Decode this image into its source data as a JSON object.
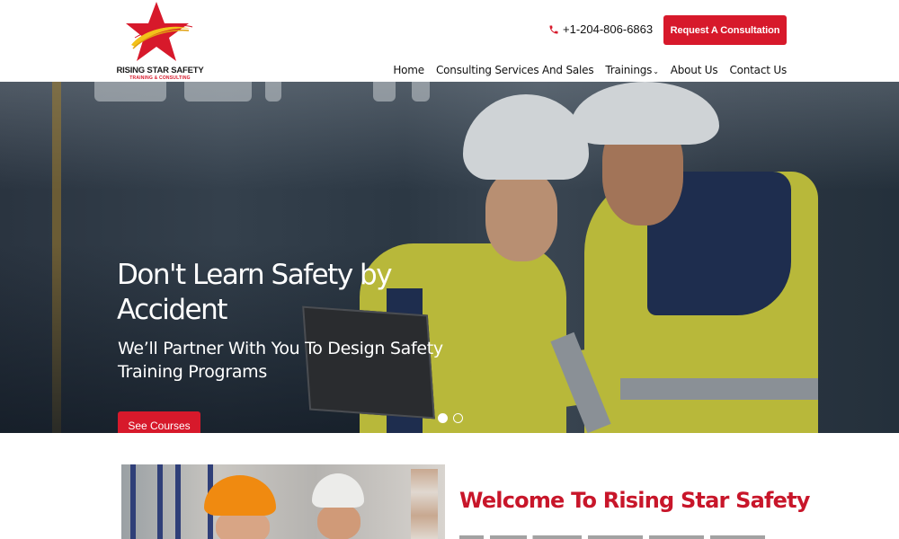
{
  "brand": {
    "name": "RISING STAR SAFETY",
    "tagline": "TRAINING & CONSULTING",
    "accent_color": "#d7192b",
    "logo_icon": "star-swoosh-icon"
  },
  "header": {
    "phone": {
      "icon": "phone-icon",
      "number": "+1-204-806-6863"
    },
    "cta_label": "Request A Consultation"
  },
  "nav": {
    "items": [
      {
        "label": "Home"
      },
      {
        "label": "Consulting Services And Sales"
      },
      {
        "label": "Trainings",
        "has_dropdown": true,
        "caret": "⌄"
      },
      {
        "label": "About Us"
      },
      {
        "label": "Contact Us"
      }
    ]
  },
  "hero": {
    "title": "Don't Learn Safety by Accident",
    "subtitle": "We’ll Partner With You To Design Safety Training Programs",
    "button_label": "See Courses",
    "slides": {
      "count": 2,
      "active_index": 0
    }
  },
  "welcome": {
    "title": "Welcome To Rising Star Safety",
    "title_color": "#c8162a"
  }
}
